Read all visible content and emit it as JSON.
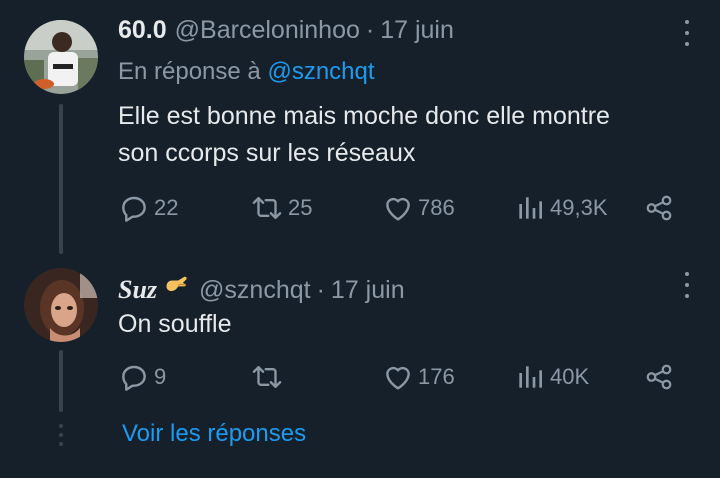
{
  "tweet1": {
    "display_name": "60.0",
    "handle": "@Barceloninhoo",
    "separator": "·",
    "date": "17 juin",
    "reply_prefix": "En réponse à",
    "reply_mention": "@sznchqt",
    "text_line1": "Elle est bonne mais moche donc elle montre",
    "text_line2": "son ccorps sur les réseaux",
    "replies": "22",
    "retweets": "25",
    "likes": "786",
    "views": "49,3K"
  },
  "tweet2": {
    "display_name": "Suz",
    "handle": "@sznchqt",
    "separator": "·",
    "date": "17 juin",
    "text": "On souffle",
    "replies": "9",
    "retweets": "",
    "likes": "176",
    "views": "40K"
  },
  "show_replies_label": "Voir les réponses",
  "icons": {
    "reply": "reply-icon",
    "retweet": "retweet-icon",
    "like": "heart-icon",
    "views": "views-chart-icon",
    "share": "share-icon",
    "more": "more-vertical-icon",
    "emoji": "pinching-hand-emoji"
  },
  "colors": {
    "background": "#15202b",
    "primary_text": "#e7e9ea",
    "secondary_text": "#8b98a5",
    "accent": "#1d9bf0",
    "thread_line": "#38444d"
  }
}
